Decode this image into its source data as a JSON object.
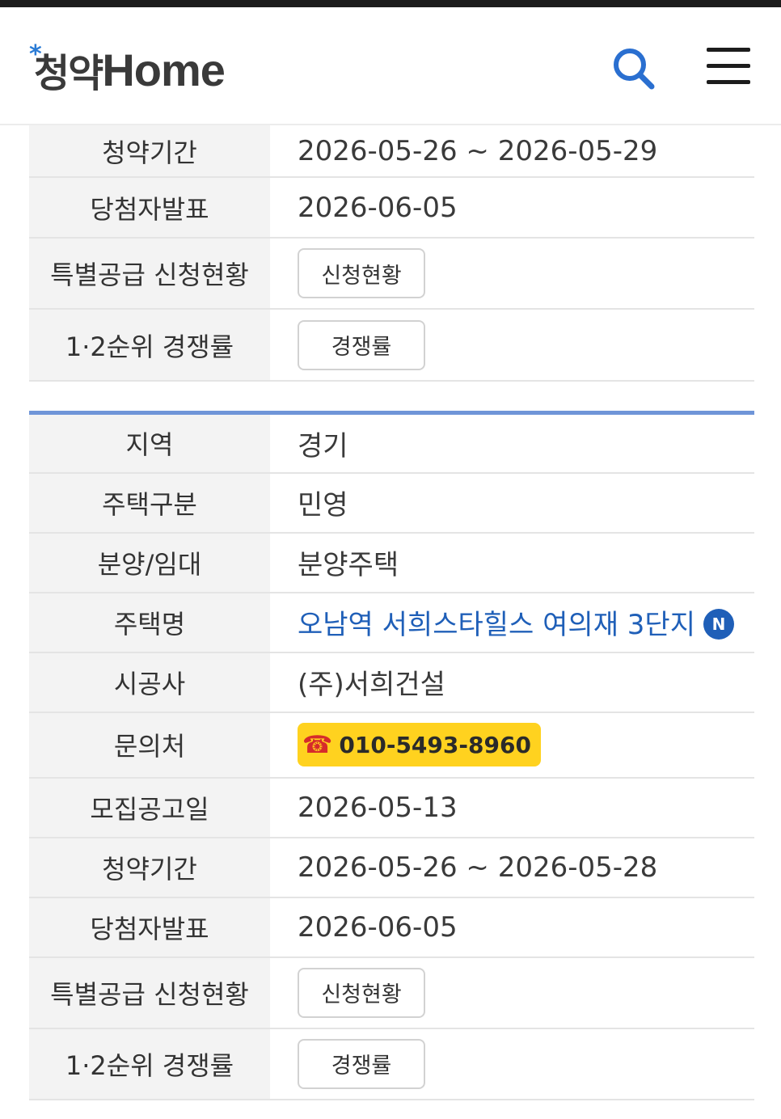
{
  "header": {
    "logo_star": "*",
    "logo_korean": "청약",
    "logo_english": "Home",
    "search_icon": "search-icon",
    "menu_icon": "hamburger-menu-icon"
  },
  "section1": {
    "rows": [
      {
        "label": "청약기간",
        "value": "2026-05-26 ~ 2026-05-29"
      },
      {
        "label": "당첨자발표",
        "value": "2026-06-05"
      },
      {
        "label": "특별공급 신청현황",
        "button": "신청현황"
      },
      {
        "label": "1·2순위 경쟁률",
        "button": "경쟁률"
      }
    ]
  },
  "section2": {
    "rows": [
      {
        "label": "지역",
        "value": "경기"
      },
      {
        "label": "주택구분",
        "value": "민영"
      },
      {
        "label": "분양/임대",
        "value": "분양주택"
      },
      {
        "label": "주택명",
        "value": "오남역 서희스타힐스 여의재 3단지",
        "badge": "N"
      },
      {
        "label": "시공사",
        "value": "(주)서희건설"
      },
      {
        "label": "문의처",
        "phone": "010-5493-8960",
        "phone_icon": "☎"
      },
      {
        "label": "모집공고일",
        "value": "2026-05-13"
      },
      {
        "label": "청약기간",
        "value": "2026-05-26 ~ 2026-05-28"
      },
      {
        "label": "당첨자발표",
        "value": "2026-06-05"
      },
      {
        "label": "특별공급 신청현황",
        "button": "신청현황"
      },
      {
        "label": "1·2순위 경쟁률",
        "button": "경쟁률"
      }
    ]
  },
  "colors": {
    "brand_blue": "#2a7bd5",
    "link_blue": "#1f5fb8",
    "divider_blue": "#6f95d8",
    "phone_yellow": "#ffd21f"
  }
}
